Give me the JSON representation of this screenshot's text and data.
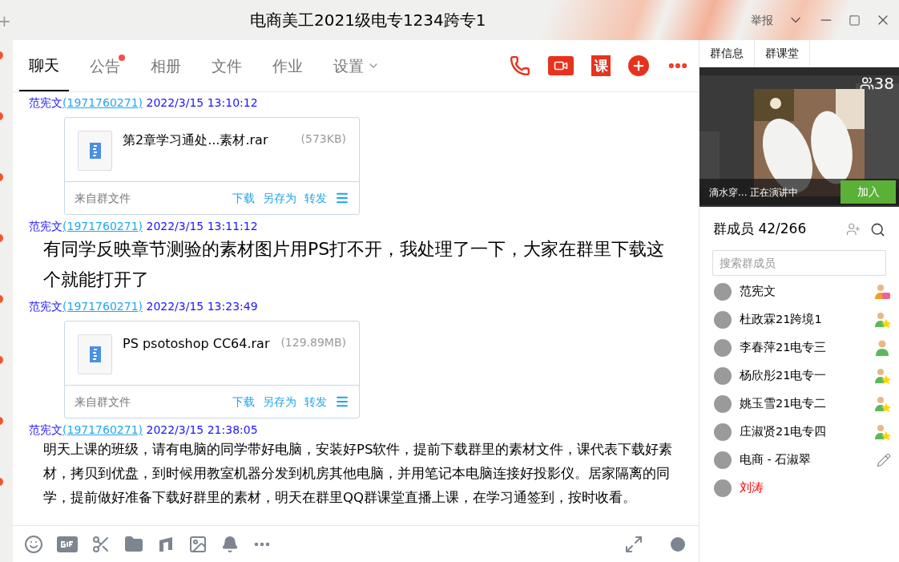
{
  "background_window": {
    "add_glyph": "+"
  },
  "window": {
    "title": "电商美工2021级电专1234跨专1",
    "report": "举报"
  },
  "tabs": [
    {
      "label": "聊天",
      "selected": true,
      "unread": false,
      "dropdown": false
    },
    {
      "label": "公告",
      "selected": false,
      "unread": true,
      "dropdown": false
    },
    {
      "label": "相册",
      "selected": false,
      "unread": false,
      "dropdown": false
    },
    {
      "label": "文件",
      "selected": false,
      "unread": false,
      "dropdown": false
    },
    {
      "label": "作业",
      "selected": false,
      "unread": false,
      "dropdown": false
    },
    {
      "label": "设置",
      "selected": false,
      "unread": false,
      "dropdown": true
    }
  ],
  "header_actions": {
    "course_label": "课"
  },
  "messages": [
    {
      "kind": "file",
      "sender": "范宪文",
      "qq": "1971760271",
      "time": "2022/3/15 13:10:12",
      "open_paren": "(",
      "close_paren": ")",
      "file_name": "第2章学习通处...素材.rar",
      "file_size": "(573KB)",
      "source": "来自群文件",
      "actions": [
        "下载",
        "另存为",
        "转发"
      ]
    },
    {
      "kind": "big_text",
      "sender": "范宪文",
      "qq": "1971760271",
      "time": "2022/3/15 13:11:12",
      "open_paren": "(",
      "close_paren": ")",
      "text": "有同学反映章节测验的素材图片用PS打不开，我处理了一下，大家在群里下载这个就能打开了"
    },
    {
      "kind": "file",
      "sender": "范宪文",
      "qq": "1971760271",
      "time": "2022/3/15 13:23:49",
      "open_paren": "(",
      "close_paren": ")",
      "file_name": "PS psotoshop CC64.rar",
      "file_size": "(129.89MB)",
      "source": "来自群文件",
      "actions": [
        "下载",
        "另存为",
        "转发"
      ]
    },
    {
      "kind": "text",
      "sender": "范宪文",
      "qq": "1971760271",
      "time": "2022/3/15 21:38:05",
      "open_paren": "(",
      "close_paren": ")",
      "text": "明天上课的班级，请有电脑的同学带好电脑，安装好PS软件，提前下载群里的素材文件，课代表下载好素材，拷贝到优盘，到时候用教室机器分发到机房其他电脑，并用笔记本电脑连接好投影仪。居家隔离的同学，提前做好准备下载好群里的素材，明天在群里QQ群课堂直播上课，在学习通签到，按时收看。"
    }
  ],
  "side_tabs": [
    {
      "label": "群信息",
      "selected": false
    },
    {
      "label": "群课堂",
      "selected": false
    }
  ],
  "live": {
    "kind": "picture",
    "viewers": "38",
    "status": "滴水穿... 正在演讲中",
    "join": "加入"
  },
  "members_panel": {
    "title": "群成员 42/266",
    "search_placeholder": "搜索群成员"
  },
  "members": [
    {
      "name": "范宪文",
      "kind": "owner",
      "color": "#000000"
    },
    {
      "name": "杜政霖21跨境1",
      "kind": "admin",
      "color": "#000000"
    },
    {
      "name": "李春萍21电专三",
      "kind": "member",
      "color": "#000000"
    },
    {
      "name": "杨欣彤21电专一",
      "kind": "admin",
      "color": "#000000"
    },
    {
      "name": "姚玉雪21电专二",
      "kind": "admin",
      "color": "#000000"
    },
    {
      "name": "庄淑贤21电专四",
      "kind": "admin",
      "color": "#000000"
    },
    {
      "name": "电商 - 石淑翠",
      "kind": "editor",
      "color": "#000000"
    },
    {
      "name": "刘涛",
      "kind": "none",
      "color": "#ff0000"
    }
  ]
}
